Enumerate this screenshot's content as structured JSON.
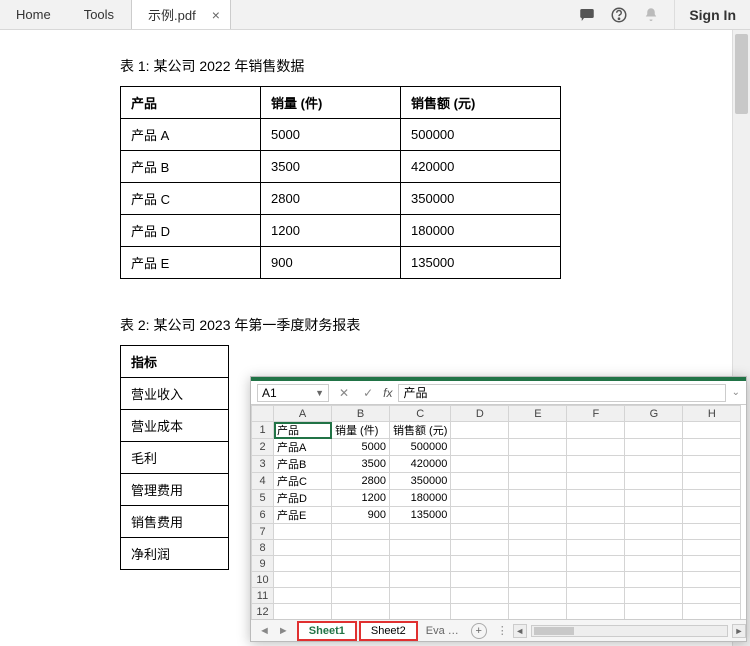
{
  "tabs": {
    "home": "Home",
    "tools": "Tools",
    "doc": "示例.pdf"
  },
  "signin": "Sign In",
  "table1": {
    "title": "表 1:   某公司 2022 年销售数据",
    "headers": [
      "产品",
      "销量 (件)",
      "销售额 (元)"
    ],
    "rows": [
      [
        "产品 A",
        "5000",
        "500000"
      ],
      [
        "产品 B",
        "3500",
        "420000"
      ],
      [
        "产品 C",
        "2800",
        "350000"
      ],
      [
        "产品 D",
        "1200",
        "180000"
      ],
      [
        "产品 E",
        "900",
        "135000"
      ]
    ]
  },
  "table2": {
    "title": "表 2:   某公司 2023 年第一季度财务报表",
    "header": "指标",
    "rows": [
      "营业收入",
      "营业成本",
      "毛利",
      "管理费用",
      "销售费用",
      "净利润"
    ]
  },
  "excel": {
    "namebox": "A1",
    "formula": "产品",
    "columns": [
      "A",
      "B",
      "C",
      "D",
      "E",
      "F",
      "G",
      "H"
    ],
    "rowcount": 12,
    "cells": {
      "1": [
        "产品",
        "销量 (件)",
        "销售额 (元)",
        "",
        "",
        "",
        "",
        ""
      ],
      "2": [
        "产品A",
        "5000",
        "500000",
        "",
        "",
        "",
        "",
        ""
      ],
      "3": [
        "产品B",
        "3500",
        "420000",
        "",
        "",
        "",
        "",
        ""
      ],
      "4": [
        "产品C",
        "2800",
        "350000",
        "",
        "",
        "",
        "",
        ""
      ],
      "5": [
        "产品D",
        "1200",
        "180000",
        "",
        "",
        "",
        "",
        ""
      ],
      "6": [
        "产品E",
        "900",
        "135000",
        "",
        "",
        "",
        "",
        ""
      ]
    },
    "sheets": {
      "s1": "Sheet1",
      "s2": "Sheet2",
      "eva": "Eva …",
      "add": "+"
    }
  }
}
